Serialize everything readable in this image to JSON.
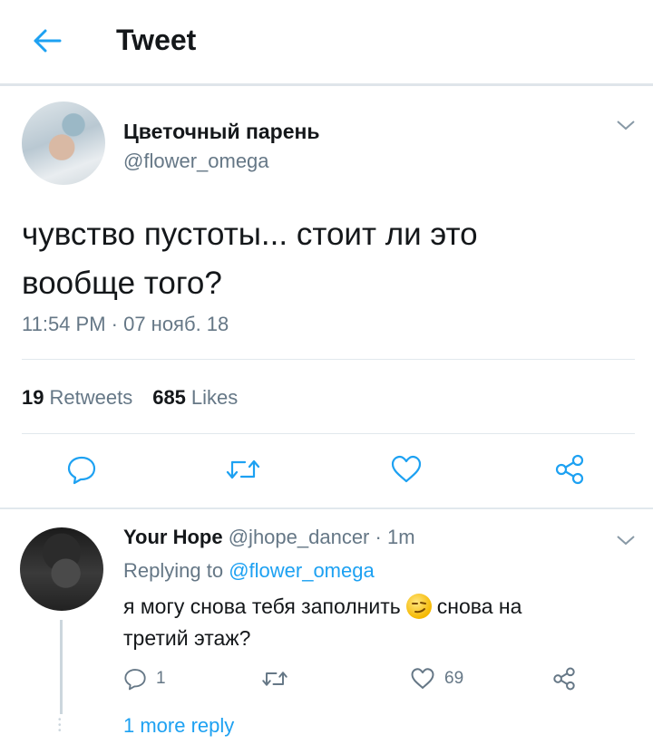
{
  "header": {
    "title": "Tweet",
    "back_icon": "back-arrow-icon"
  },
  "tweet": {
    "author_name": "Цветочный парень",
    "author_handle": "@flower_omega",
    "text_lines": [
      "чувство пустоты... стоит ли это",
      "вообще того?"
    ],
    "timestamp": "11:54 PM · 07 нояб. 18",
    "retweets_count": "19",
    "retweets_label": "Retweets",
    "likes_count": "685",
    "likes_label": "Likes",
    "actions": [
      "reply-icon",
      "retweet-icon",
      "like-icon",
      "share-icon"
    ]
  },
  "reply": {
    "author_name": "Your Hope",
    "author_handle": "@jhope_dancer",
    "separator": " · ",
    "time": "1m",
    "replying_to_prefix": "Replying to ",
    "replying_to_handle": "@flower_omega",
    "text_line1_before": "я могу снова тебя заполнить",
    "text_line1_after": "снова на",
    "text_line2": "третий этаж?",
    "emoji": "smirking-face-emoji",
    "reply_count": "1",
    "retweet_count": "",
    "like_count": "69",
    "more_replies": "1 more reply"
  },
  "colors": {
    "accent": "#1da1f2",
    "secondary_text": "#657786",
    "divider": "#e1e8ed"
  }
}
